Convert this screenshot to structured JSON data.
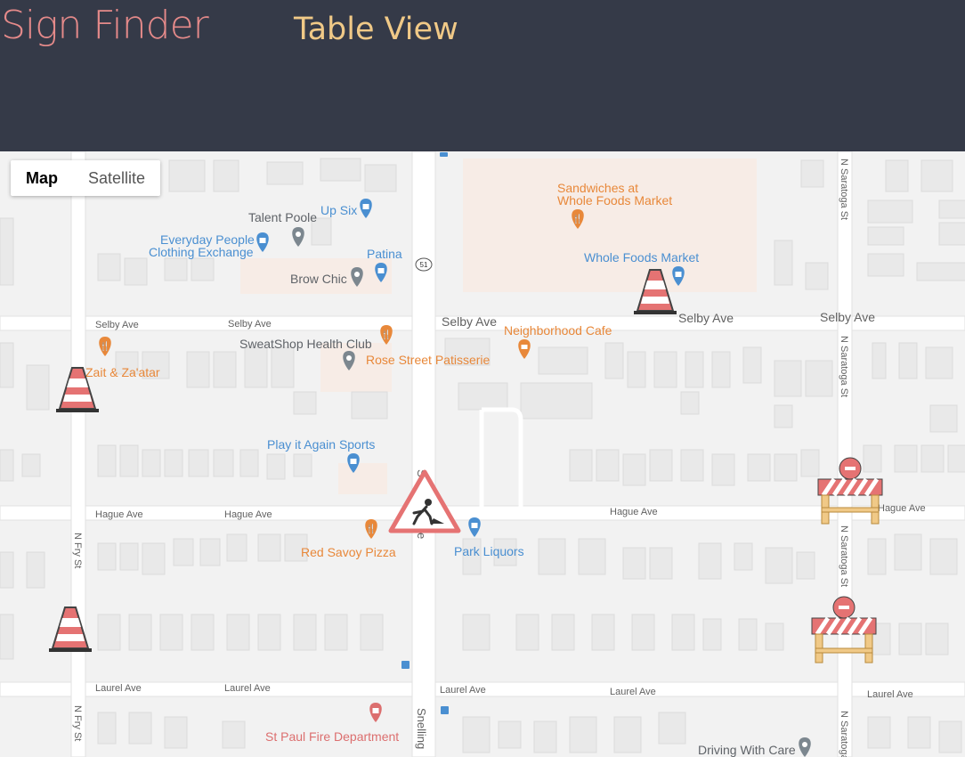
{
  "header": {
    "brand": "Sign Finder",
    "nav_table_view": "Table View",
    "brand_color": "#e58a8a",
    "nav_color": "#f0c987",
    "background": "#353a48"
  },
  "map_type": {
    "map_label": "Map",
    "satellite_label": "Satellite",
    "selected": "Map"
  },
  "streets": [
    {
      "id": "selby-ave-w1",
      "name": "Selby Ave"
    },
    {
      "id": "selby-ave-w2",
      "name": "Selby Ave"
    },
    {
      "id": "selby-ave-c",
      "name": "Selby Ave"
    },
    {
      "id": "selby-ave-e1",
      "name": "Selby Ave"
    },
    {
      "id": "selby-ave-e2",
      "name": "Selby Ave"
    },
    {
      "id": "hague-ave-w1",
      "name": "Hague Ave"
    },
    {
      "id": "hague-ave-w2",
      "name": "Hague Ave"
    },
    {
      "id": "hague-ave-e1",
      "name": "Hague Ave"
    },
    {
      "id": "hague-ave-e2",
      "name": "Hague Ave"
    },
    {
      "id": "laurel-ave-w1",
      "name": "Laurel Ave"
    },
    {
      "id": "laurel-ave-w2",
      "name": "Laurel Ave"
    },
    {
      "id": "laurel-ave-c",
      "name": "Laurel Ave"
    },
    {
      "id": "laurel-ave-e1",
      "name": "Laurel Ave"
    },
    {
      "id": "laurel-ave-e2",
      "name": "Laurel Ave"
    },
    {
      "id": "n-fry-st-1",
      "name": "N Fry St"
    },
    {
      "id": "n-fry-st-2",
      "name": "N Fry St"
    },
    {
      "id": "n-saratoga-st-1",
      "name": "N Saratoga St"
    },
    {
      "id": "n-saratoga-st-2",
      "name": "N Saratoga St"
    },
    {
      "id": "n-saratoga-st-3",
      "name": "N Saratoga St"
    },
    {
      "id": "n-saratoga-st-4",
      "name": "N Saratoga St"
    },
    {
      "id": "snelling-1",
      "name": "Snelling"
    },
    {
      "id": "snelling-2",
      "name": "S"
    },
    {
      "id": "snelling-3",
      "name": "e"
    },
    {
      "id": "highway-shield",
      "name": "51"
    }
  ],
  "places": [
    {
      "id": "sandwiches",
      "name": "Sandwiches at\nWhole Foods Market",
      "kind": "food",
      "color": "#e8883a"
    },
    {
      "id": "talent-poole",
      "name": "Talent Poole",
      "kind": "place",
      "color": "#5f6368"
    },
    {
      "id": "up-six",
      "name": "Up Six",
      "kind": "shop",
      "color": "#4a8fd1"
    },
    {
      "id": "everyday-people",
      "name": "Everyday People\nClothing Exchange",
      "kind": "shop",
      "color": "#4a8fd1"
    },
    {
      "id": "patina",
      "name": "Patina",
      "kind": "shop",
      "color": "#4a8fd1"
    },
    {
      "id": "brow-chic",
      "name": "Brow Chic",
      "kind": "place",
      "color": "#5f6368"
    },
    {
      "id": "whole-foods",
      "name": "Whole Foods Market",
      "kind": "shop",
      "color": "#4a8fd1"
    },
    {
      "id": "neighborhood-cafe",
      "name": "Neighborhood Cafe",
      "kind": "food",
      "color": "#e8883a"
    },
    {
      "id": "sweatshop",
      "name": "SweatShop Health Club",
      "kind": "place",
      "color": "#5f6368"
    },
    {
      "id": "rose-street",
      "name": "Rose Street Patisserie",
      "kind": "food",
      "color": "#e8883a"
    },
    {
      "id": "zait",
      "name": "Zait & Za'atar",
      "kind": "food",
      "color": "#e8883a"
    },
    {
      "id": "play-it-again",
      "name": "Play it Again Sports",
      "kind": "shop",
      "color": "#4a8fd1"
    },
    {
      "id": "red-savoy",
      "name": "Red Savoy Pizza",
      "kind": "food",
      "color": "#e8883a"
    },
    {
      "id": "park-liquors",
      "name": "Park Liquors",
      "kind": "shop",
      "color": "#4a8fd1"
    },
    {
      "id": "fire-dept",
      "name": "St Paul Fire Department",
      "kind": "civic",
      "color": "#dc6f6f"
    },
    {
      "id": "driving-with-care",
      "name": "Driving With Care",
      "kind": "place",
      "color": "#5f6368"
    }
  ],
  "signs": [
    {
      "id": "cone-1",
      "type": "traffic-cone"
    },
    {
      "id": "cone-2",
      "type": "traffic-cone"
    },
    {
      "id": "cone-3",
      "type": "traffic-cone"
    },
    {
      "id": "roadwork-1",
      "type": "road-work-sign"
    },
    {
      "id": "barrier-1",
      "type": "road-closed-barrier"
    },
    {
      "id": "barrier-2",
      "type": "road-closed-barrier"
    }
  ]
}
